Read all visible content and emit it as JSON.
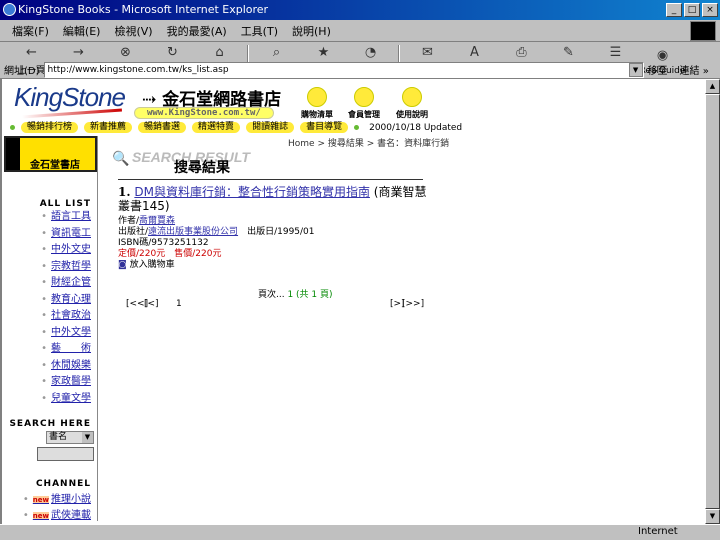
{
  "window": {
    "title": "KingStone Books - Microsoft Internet Explorer",
    "controls": [
      "_",
      "□",
      "×"
    ]
  },
  "menu": [
    "檔案(F)",
    "編輯(E)",
    "檢視(V)",
    "我的最愛(A)",
    "工具(T)",
    "說明(H)"
  ],
  "toolbar": [
    {
      "label": "上一頁",
      "icon": "←"
    },
    {
      "label": "下一頁",
      "icon": "→"
    },
    {
      "label": "停止",
      "icon": "⊗"
    },
    {
      "label": "重新整理",
      "icon": "↻"
    },
    {
      "label": "首頁",
      "icon": "⌂"
    },
    {
      "label": "搜尋",
      "icon": "⌕"
    },
    {
      "label": "我的最愛",
      "icon": "★"
    },
    {
      "label": "記錄",
      "icon": "◔"
    },
    {
      "label": "郵件",
      "icon": "✉"
    },
    {
      "label": "字型",
      "icon": "A"
    },
    {
      "label": "列印",
      "icon": "⎙"
    },
    {
      "label": "編輯",
      "icon": "✎"
    },
    {
      "label": "討論",
      "icon": "☰"
    },
    {
      "label": "RealGuide",
      "icon": "◉"
    }
  ],
  "address": {
    "label": "網址(D)",
    "url": "http://www.kingstone.com.tw/ks_list.asp",
    "go": "移至",
    "links": "連結 »"
  },
  "header": {
    "logo": "KingStone",
    "name": "金石堂網路書店",
    "url": "www.KingStone.com.tw/",
    "icons": [
      "購物清單",
      "會員管理",
      "使用說明"
    ],
    "nav": [
      "暢銷排行榜",
      "新書推薦",
      "暢銷書選",
      "精選特賣",
      "閱讀雜誌",
      "書目導覽"
    ],
    "updated": "2000/10/18 Updated"
  },
  "sidebar": {
    "brand": "金石堂書店",
    "all_list": "ALL LIST",
    "categories": [
      "語言工具",
      "資訊電工",
      "中外文史",
      "宗教哲學",
      "財經企管",
      "教育心理",
      "社會政治",
      "中外文學",
      "藝　　術",
      "休閒娛樂",
      "家政醫學",
      "兒童文學"
    ],
    "search_here": "SEARCH HERE",
    "search_select": "書名",
    "channel": "CHANNEL",
    "new_badge": "new",
    "channels": [
      "推理小說",
      "武俠連載"
    ]
  },
  "main": {
    "breadcrumb": "Home > 搜尋結果 > 書名：資料庫行銷",
    "search_result_en": "SEARCH RESULT",
    "search_result": "搜尋結果",
    "book": {
      "num": "1.",
      "title": "DM與資料庫行銷：整合性行銷策略實用指南",
      "series": "(商業智慧叢書145)",
      "author_label": "作者/",
      "author": "喬爾賈森",
      "publisher_label": "出版社/",
      "publisher": "遠流出版事業股份公司",
      "pubdate": "出版日/1995/01",
      "isbn": "ISBN碼/9573251132",
      "list_price": "定價/220元",
      "sale_price": "售價/220元",
      "cart": "放入購物車"
    },
    "pages_label": "頁次... ",
    "pages_cur": "1 (共 1 頁)",
    "first": "[<<]",
    "prev": "[<]",
    "page": "1",
    "next": "[>]",
    "last": "[>>]"
  },
  "status": {
    "zone": "Internet"
  }
}
